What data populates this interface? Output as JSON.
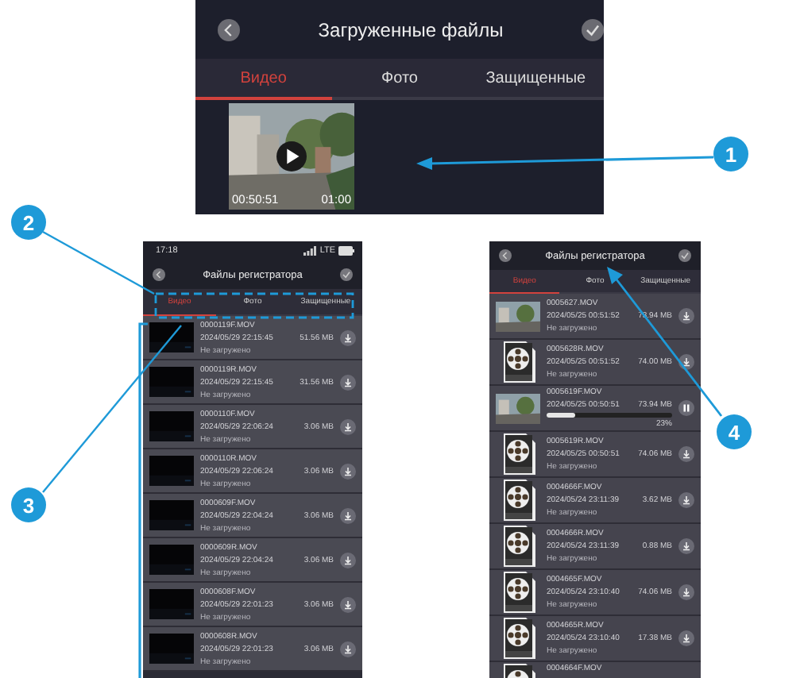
{
  "top_screen": {
    "title": "Загруженные файлы",
    "tabs": [
      {
        "label": "Видео",
        "selected": true
      },
      {
        "label": "Фото",
        "selected": false
      },
      {
        "label": "Защищенные",
        "selected": false
      }
    ],
    "video": {
      "elapsed": "00:50:51",
      "duration": "01:00"
    }
  },
  "phones": [
    {
      "status_bar": {
        "time": "17:18",
        "network": "LTE"
      },
      "title": "Файлы регистратора",
      "tabs": [
        {
          "label": "Видео",
          "selected": true
        },
        {
          "label": "Фото",
          "selected": false
        },
        {
          "label": "Защищенные",
          "selected": false
        }
      ],
      "files": [
        {
          "name": "0000119F.MOV",
          "datetime": "2024/05/29 22:15:45",
          "size": "51.56 MB",
          "status": "Не загружено",
          "kind": "dark",
          "downloading": false
        },
        {
          "name": "0000119R.MOV",
          "datetime": "2024/05/29 22:15:45",
          "size": "31.56 MB",
          "status": "Не загружено",
          "kind": "dark",
          "downloading": false
        },
        {
          "name": "0000110F.MOV",
          "datetime": "2024/05/29 22:06:24",
          "size": "3.06 MB",
          "status": "Не загружено",
          "kind": "dark",
          "downloading": false
        },
        {
          "name": "0000110R.MOV",
          "datetime": "2024/05/29 22:06:24",
          "size": "3.06 MB",
          "status": "Не загружено",
          "kind": "dark",
          "downloading": false
        },
        {
          "name": "0000609F.MOV",
          "datetime": "2024/05/29 22:04:24",
          "size": "3.06 MB",
          "status": "Не загружено",
          "kind": "dark",
          "downloading": false
        },
        {
          "name": "0000609R.MOV",
          "datetime": "2024/05/29 22:04:24",
          "size": "3.06 MB",
          "status": "Не загружено",
          "kind": "dark",
          "downloading": false
        },
        {
          "name": "0000608F.MOV",
          "datetime": "2024/05/29 22:01:23",
          "size": "3.06 MB",
          "status": "Не загружено",
          "kind": "dark",
          "downloading": false
        },
        {
          "name": "0000608R.MOV",
          "datetime": "2024/05/29 22:01:23",
          "size": "3.06 MB",
          "status": "Не загружено",
          "kind": "dark",
          "downloading": false
        }
      ]
    },
    {
      "title": "Файлы регистратора",
      "tabs": [
        {
          "label": "Видео",
          "selected": true
        },
        {
          "label": "Фото",
          "selected": false
        },
        {
          "label": "Защищенные",
          "selected": false
        }
      ],
      "files": [
        {
          "name": "0005627.MOV",
          "datetime": "2024/05/25 00:51:52",
          "size": "73.94 MB",
          "status": "Не загружено",
          "downloading": false
        },
        {
          "name": "0005628R.MOV",
          "datetime": "2024/05/25 00:51:52",
          "size": "74.00 MB",
          "status": "Не загружено",
          "kind": "file",
          "downloading": false
        },
        {
          "name": "0005619F.MOV",
          "datetime": "2024/05/25 00:50:51",
          "size": "73.94 MB",
          "level": 0.23,
          "percent": "23%",
          "downloading": true
        },
        {
          "name": "0005619R.MOV",
          "datetime": "2024/05/25 00:50:51",
          "size": "74.06 MB",
          "status": "Не загружено",
          "kind": "file",
          "downloading": false
        },
        {
          "name": "0004666F.MOV",
          "datetime": "2024/05/24 23:11:39",
          "size": "3.62 MB",
          "status": "Не загружено",
          "kind": "file",
          "downloading": false
        },
        {
          "name": "0004666R.MOV",
          "datetime": "2024/05/24 23:11:39",
          "size": "0.88 MB",
          "status": "Не загружено",
          "kind": "file",
          "downloading": false
        },
        {
          "name": "0004665F.MOV",
          "datetime": "2024/05/24 23:10:40",
          "size": "74.06 MB",
          "status": "Не загружено",
          "kind": "file",
          "downloading": false
        },
        {
          "name": "0004665R.MOV",
          "datetime": "2024/05/24 23:10:40",
          "size": "17.38 MB",
          "status": "Не загружено",
          "kind": "file",
          "downloading": false
        },
        {
          "name": "0004664F.MOV",
          "kind": "file"
        }
      ]
    }
  ],
  "callouts": [
    {
      "number": "1"
    },
    {
      "number": "2"
    },
    {
      "number": "3"
    },
    {
      "number": "4"
    }
  ]
}
